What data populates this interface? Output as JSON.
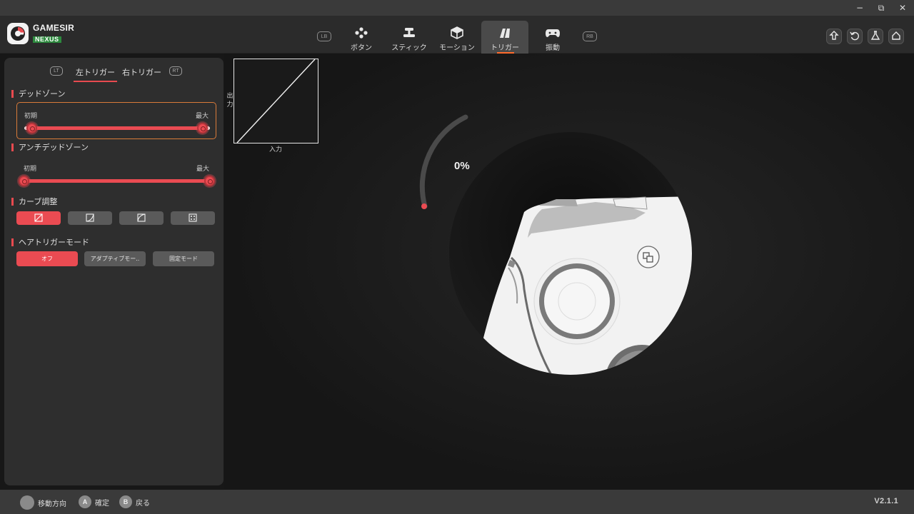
{
  "window": {
    "controls": {
      "minimize": "−",
      "restore": "⧉",
      "close": "✕"
    }
  },
  "brand": {
    "line1": "GAMESIR",
    "line2": "NEXUS"
  },
  "nav": {
    "left_bumper": "LB",
    "right_bumper": "RB",
    "tabs": [
      {
        "label": "ボタン",
        "icon": "buttons-icon"
      },
      {
        "label": "スティック",
        "icon": "stick-icon"
      },
      {
        "label": "モーション",
        "icon": "motion-icon"
      },
      {
        "label": "トリガー",
        "icon": "trigger-icon",
        "active": true
      },
      {
        "label": "振動",
        "icon": "vibration-icon"
      }
    ],
    "right_buttons": [
      "upload-icon",
      "reset-icon",
      "lab-icon",
      "home-icon"
    ]
  },
  "side_panel": {
    "lt_pill": "LT",
    "rt_pill": "RT",
    "tabs": [
      {
        "label": "左トリガー",
        "active": true
      },
      {
        "label": "右トリガー",
        "active": false
      }
    ],
    "deadzone": {
      "title": "デッドゾーン",
      "min_label": "初期",
      "max_label": "最大",
      "low_value": 0.04,
      "high_value": 0.96
    },
    "anti_deadzone": {
      "title": "アンチデッドゾーン",
      "min_label": "初期",
      "max_label": "最大",
      "low_value": 0.0,
      "high_value": 1.0
    },
    "curve": {
      "title": "カーブ調整",
      "options": [
        "linear-curve-icon",
        "delay-curve-icon",
        "aggressive-curve-icon",
        "custom-curve-icon"
      ],
      "selected_index": 0
    },
    "hair_trigger": {
      "title": "ヘアトリガーモード",
      "options": [
        "オフ",
        "アダプティブモー..",
        "固定モード"
      ],
      "selected_index": 0
    }
  },
  "graph": {
    "y_label": "出力",
    "x_label": "入力"
  },
  "trigger_visual": {
    "percent": "0%",
    "value": 0
  },
  "bottom": {
    "hints": [
      {
        "key": "",
        "label": "移動方向"
      },
      {
        "key": "A",
        "label": "確定"
      },
      {
        "key": "B",
        "label": "戻る"
      }
    ],
    "version": "V2.1.1"
  },
  "colors": {
    "accent": "#ea4b52",
    "focus": "#d97b3a",
    "tab_underline": "#ff6b2c"
  }
}
